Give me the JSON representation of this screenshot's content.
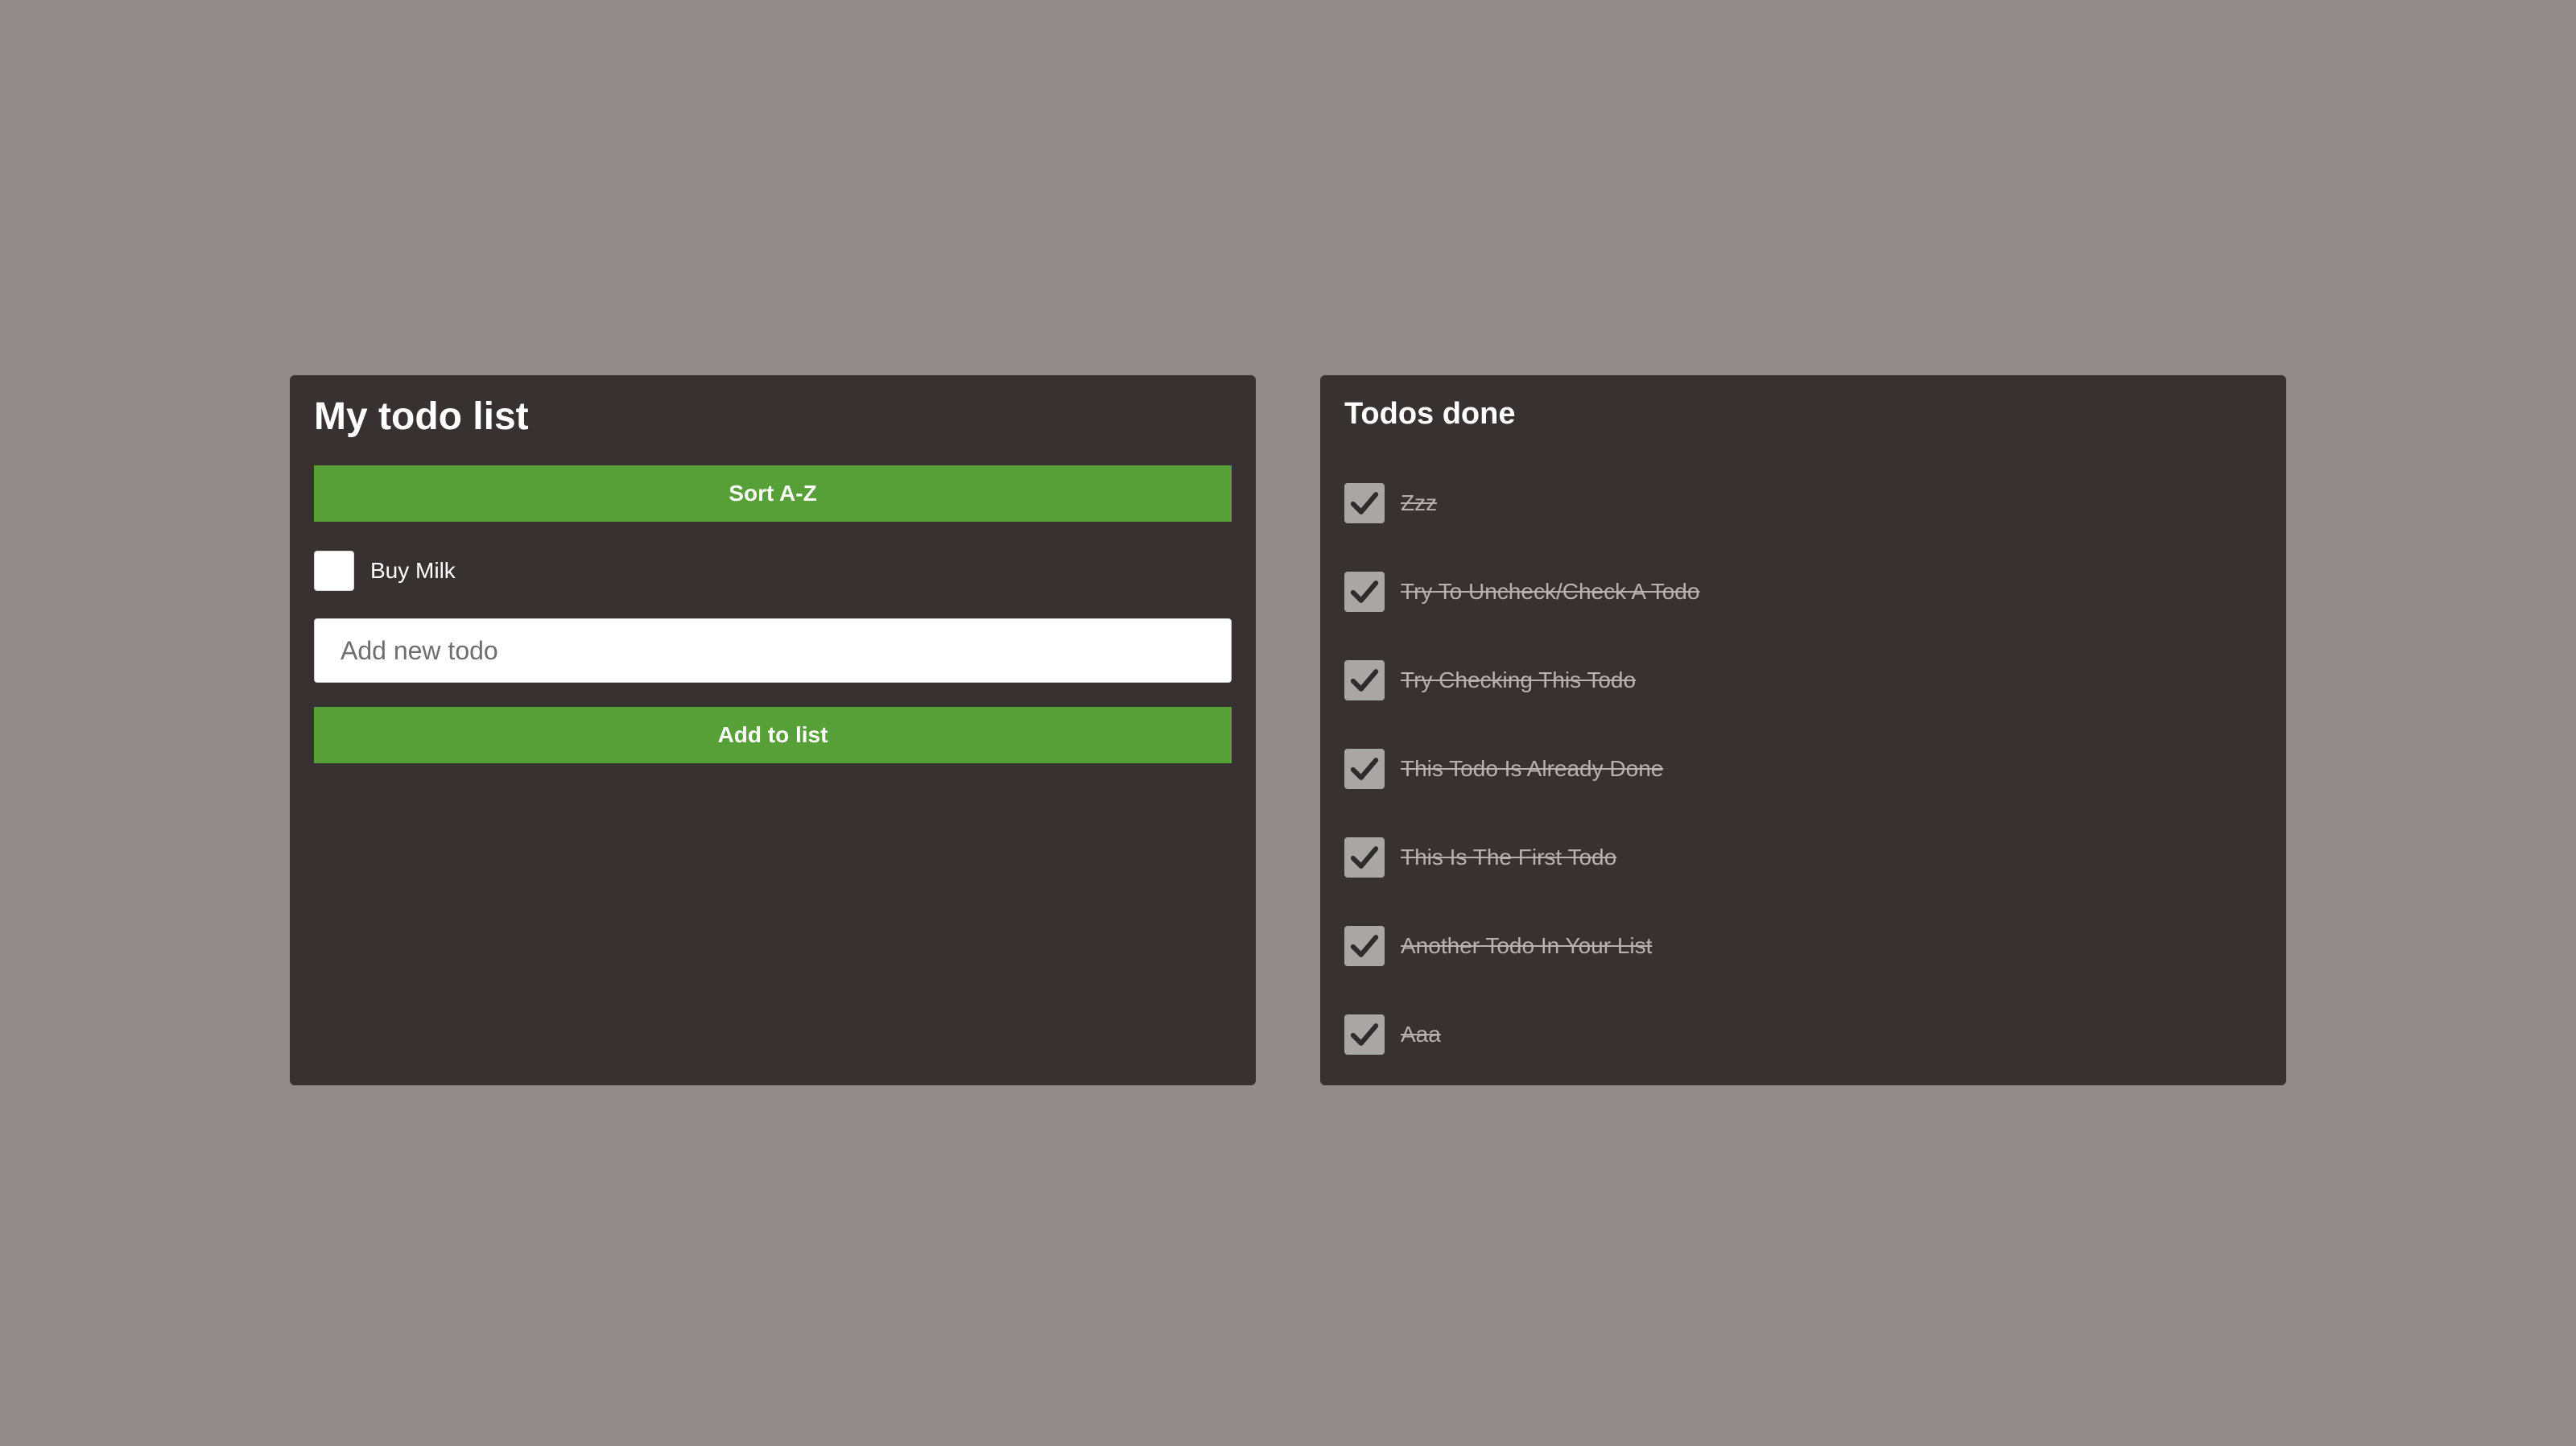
{
  "todo_panel": {
    "title": "My todo list",
    "sort_label": "Sort A-Z",
    "pending_items": [
      {
        "label": "Buy Milk",
        "checked": false
      }
    ],
    "input": {
      "placeholder": "Add new todo",
      "value": ""
    },
    "add_label": "Add to list"
  },
  "done_panel": {
    "title": "Todos done",
    "items": [
      {
        "label": "Zzz",
        "checked": true
      },
      {
        "label": "Try To Uncheck/Check A Todo",
        "checked": true
      },
      {
        "label": "Try Checking This Todo",
        "checked": true
      },
      {
        "label": "This Todo Is Already Done",
        "checked": true
      },
      {
        "label": "This Is The First Todo",
        "checked": true
      },
      {
        "label": "Another Todo In Your List",
        "checked": true
      },
      {
        "label": "Aaa",
        "checked": true
      }
    ]
  },
  "icons": {
    "done_checkbox": "check-icon"
  },
  "colors": {
    "background": "#938a8a",
    "panel": "#373132",
    "accent_green": "#57a037",
    "done_text": "#b6b0b0",
    "checkbox_checked": "#a9a6a6"
  }
}
